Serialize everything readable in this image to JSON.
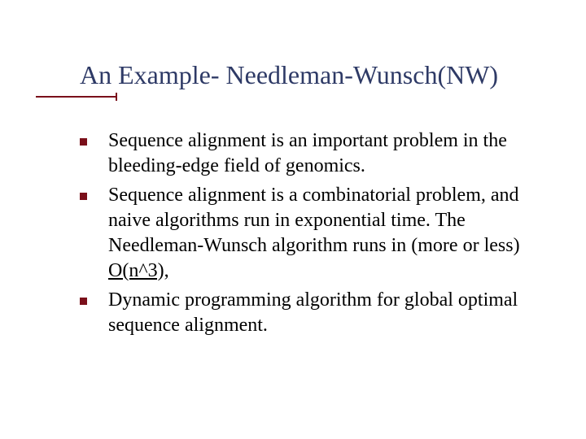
{
  "title": "An Example- Needleman-Wunsch(NW)",
  "bullets": [
    {
      "pre": "Sequence alignment is an important problem in the bleeding-edge field of genomics.",
      "emph": "",
      "post": ""
    },
    {
      "pre": "Sequence alignment is a combinatorial problem, and naive algorithms run in exponential time. The Needleman-Wunsch algorithm runs in (more or less) ",
      "emph": "O(n^3),",
      "post": ""
    },
    {
      "pre": "Dynamic programming algorithm for global optimal sequence alignment.",
      "emph": "",
      "post": ""
    }
  ]
}
